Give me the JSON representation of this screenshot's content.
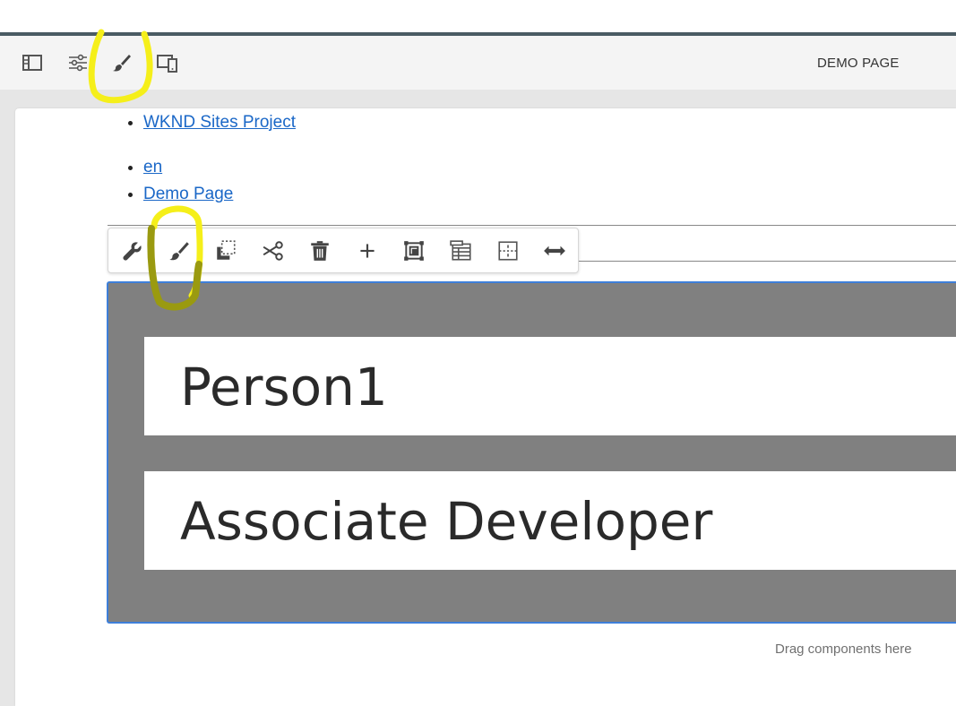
{
  "toolbar": {
    "page_title": "DEMO PAGE",
    "icons": [
      "side-panel-icon",
      "page-properties-icon",
      "style-icon",
      "emulator-icon"
    ]
  },
  "breadcrumbs": {
    "group1": [
      "WKND Sites Project"
    ],
    "group2": [
      "en",
      "Demo Page"
    ]
  },
  "edit_toolbar": {
    "icons": [
      "configure-icon",
      "style-icon",
      "copy-icon",
      "cut-icon",
      "delete-icon",
      "insert-icon",
      "group-icon",
      "layout-icon",
      "parent-icon",
      "resize-icon"
    ]
  },
  "container": {
    "title1": "Person1",
    "title2": "Associate Developer"
  },
  "drag_placeholder": "Drag components here",
  "colors": {
    "link": "#1a67c7",
    "container_bg": "#808080",
    "selection_border": "#3e7fd9",
    "highlight_bright": "#f5ef1a",
    "highlight_dark": "#9a9a10"
  }
}
